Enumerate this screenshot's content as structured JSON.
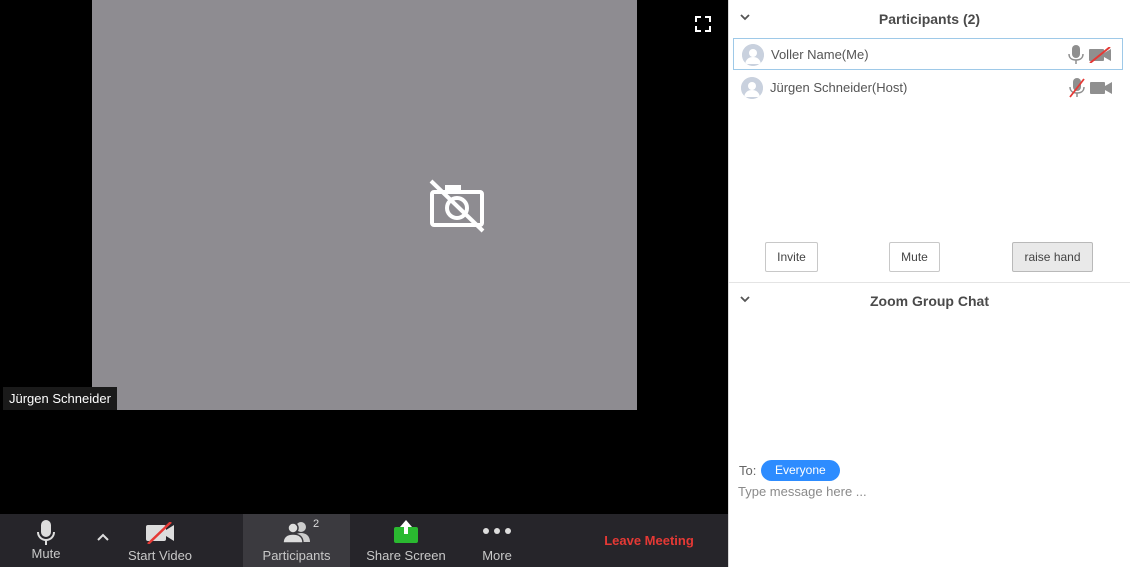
{
  "video": {
    "participant_name": "Jürgen Schneider"
  },
  "toolbar": {
    "mute_label": "Mute",
    "start_video_label": "Start Video",
    "participants_label": "Participants",
    "participants_count": "2",
    "share_label": "Share Screen",
    "more_label": "More",
    "leave_label": "Leave Meeting"
  },
  "participants_panel": {
    "title": "Participants (2)",
    "items": [
      {
        "name": "Voller Name(Me)",
        "mic": "mic-on",
        "video": "video-off"
      },
      {
        "name": "Jürgen Schneider(Host)",
        "mic": "mic-muted",
        "video": "video-on"
      }
    ],
    "invite_label": "Invite",
    "mute_label": "Mute",
    "raise_hand_label": "raise hand"
  },
  "chat": {
    "title": "Zoom Group Chat",
    "to_label": "To:",
    "to_target": "Everyone",
    "placeholder": "Type message here ..."
  },
  "colors": {
    "accent": "#2d8cff",
    "leave": "#e53935",
    "share": "#2ab930",
    "muted_red": "#e53935"
  }
}
